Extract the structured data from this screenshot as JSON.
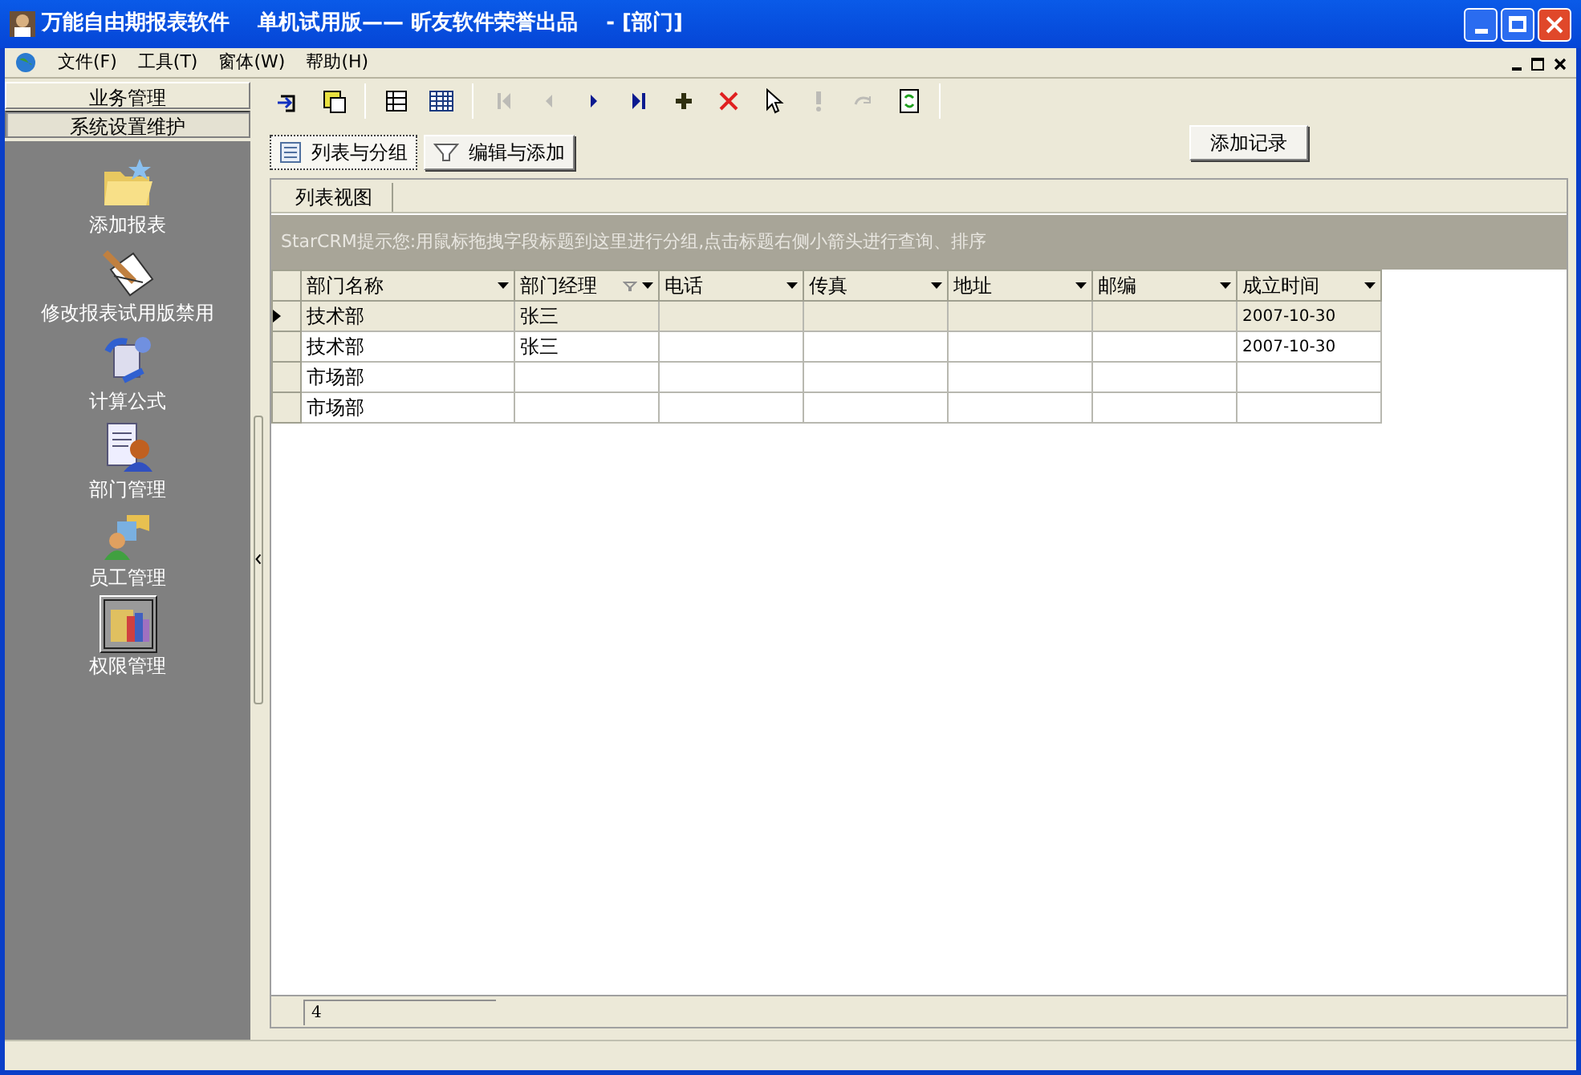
{
  "window": {
    "title": "万能自由期报表软件　 单机试用版—— 昕友软件荣誉出品　 - [部门]"
  },
  "menu": [
    "文件(F)",
    "工具(T)",
    "窗体(W)",
    "帮助(H)"
  ],
  "sidebar": {
    "sections": [
      {
        "label": "业务管理",
        "selected": false
      },
      {
        "label": "系统设置维护",
        "selected": true
      }
    ],
    "items": [
      {
        "label": "添加报表",
        "kind": "folder",
        "selected": false
      },
      {
        "label": "修改报表试用版禁用",
        "kind": "edit",
        "selected": false
      },
      {
        "label": "计算公式",
        "kind": "formula",
        "selected": false
      },
      {
        "label": "部门管理",
        "kind": "department",
        "selected": false
      },
      {
        "label": "员工管理",
        "kind": "staff",
        "selected": false
      },
      {
        "label": "权限管理",
        "kind": "permission",
        "selected": true
      }
    ]
  },
  "toolbar": [
    {
      "kind": "enter",
      "disabled": false
    },
    {
      "kind": "save",
      "disabled": false
    },
    {
      "kind": "sep"
    },
    {
      "kind": "list",
      "disabled": false
    },
    {
      "kind": "grid",
      "disabled": false
    },
    {
      "kind": "sep"
    },
    {
      "kind": "first",
      "disabled": true
    },
    {
      "kind": "prev",
      "disabled": true
    },
    {
      "kind": "next",
      "disabled": false
    },
    {
      "kind": "last",
      "disabled": false
    },
    {
      "kind": "add",
      "disabled": false
    },
    {
      "kind": "delete",
      "disabled": false
    },
    {
      "kind": "pointer",
      "disabled": false
    },
    {
      "kind": "alert",
      "disabled": true
    },
    {
      "kind": "undo",
      "disabled": true
    },
    {
      "kind": "refresh",
      "disabled": false
    },
    {
      "kind": "sep"
    }
  ],
  "view_buttons": [
    {
      "label": "列表与分组",
      "selected": true
    },
    {
      "label": "编辑与添加",
      "selected": false
    }
  ],
  "add_record_button": "添加记录",
  "tabs": [
    {
      "label": "列表视图",
      "selected": true
    }
  ],
  "group_hint": "StarCRM提示您:用鼠标拖拽字段标题到这里进行分组,点击标题右侧小箭头进行查询、排序",
  "table": {
    "columns": [
      {
        "label": "部门名称",
        "filtered": false
      },
      {
        "label": "部门经理",
        "filtered": true
      },
      {
        "label": "电话",
        "filtered": false
      },
      {
        "label": "传真",
        "filtered": false
      },
      {
        "label": "地址",
        "filtered": false
      },
      {
        "label": "邮编",
        "filtered": false
      },
      {
        "label": "成立时间",
        "filtered": false
      }
    ],
    "rows": [
      {
        "selected": true,
        "cells": [
          "技术部",
          "张三",
          "",
          "",
          "",
          "",
          "2007-10-30"
        ]
      },
      {
        "selected": false,
        "cells": [
          "技术部",
          "张三",
          "",
          "",
          "",
          "",
          "2007-10-30"
        ]
      },
      {
        "selected": false,
        "cells": [
          "市场部",
          "",
          "",
          "",
          "",
          "",
          ""
        ]
      },
      {
        "selected": false,
        "cells": [
          "市场部",
          "",
          "",
          "",
          "",
          "",
          ""
        ]
      }
    ]
  },
  "footer": {
    "record_count": "4"
  }
}
